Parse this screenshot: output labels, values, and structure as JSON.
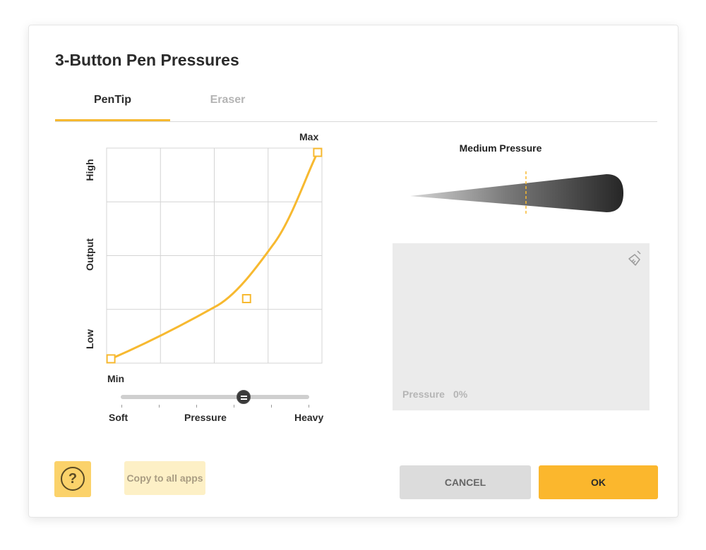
{
  "dialog": {
    "title": "3-Button Pen Pressures",
    "tabs": [
      {
        "label": "PenTip",
        "active": true
      },
      {
        "label": "Eraser",
        "active": false
      }
    ]
  },
  "curve": {
    "max_label": "Max",
    "min_label": "Min",
    "y_labels": {
      "high": "High",
      "middle": "Output",
      "low": "Low"
    },
    "x_labels": {
      "soft": "Soft",
      "middle": "Pressure",
      "heavy": "Heavy"
    },
    "control_points": [
      {
        "name": "min",
        "x": 0.02,
        "y": 0.02
      },
      {
        "name": "mid",
        "x": 0.65,
        "y": 0.3
      },
      {
        "name": "max",
        "x": 0.98,
        "y": 0.98
      }
    ],
    "grid_divisions": 4,
    "curve_color": "#f7b930"
  },
  "slider": {
    "value": 0.65,
    "ticks": 6
  },
  "preview": {
    "title": "Medium Pressure",
    "pressure_label": "Pressure",
    "pressure_value": "0%",
    "clear_icon": "broom-icon"
  },
  "footer": {
    "help_icon": "question-mark-icon",
    "help_symbol": "?",
    "copy_label": "Copy to all apps",
    "cancel_label": "CANCEL",
    "ok_label": "OK"
  },
  "colors": {
    "accent": "#f7b930",
    "ok_button": "#fbb72d",
    "help_button": "#fbd26a",
    "copy_button": "#fdf0c6",
    "cancel_button": "#dcdcdc"
  }
}
